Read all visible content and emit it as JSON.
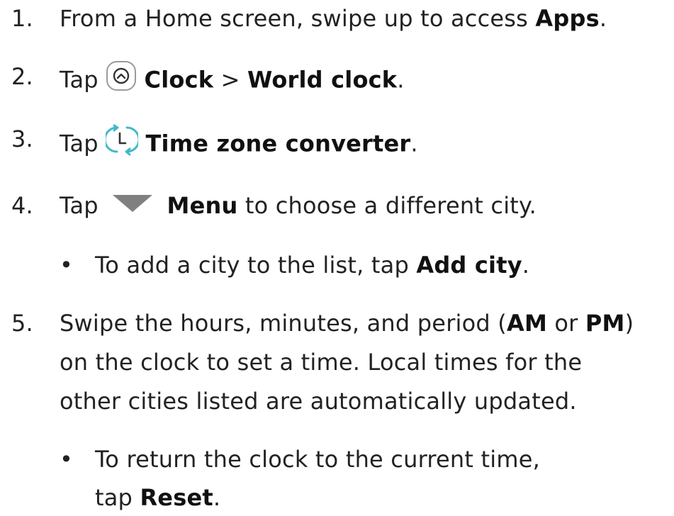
{
  "colors": {
    "text": "#222222",
    "icon_teal": "#3fb8c9",
    "icon_gray": "#808080"
  },
  "steps": [
    {
      "number": "1.",
      "prefix": "From a Home screen, swipe up to access ",
      "bold": "Apps",
      "suffix": "."
    },
    {
      "number": "2.",
      "prefix": "Tap",
      "icon": "clock-app-icon",
      "bold1": "Clock",
      "separator": " > ",
      "bold2": "World clock",
      "suffix": "."
    },
    {
      "number": "3.",
      "prefix": "Tap",
      "icon": "time-zone-converter-icon",
      "bold": "Time zone converter",
      "suffix": "."
    },
    {
      "number": "4.",
      "prefix": "Tap",
      "icon": "menu-triangle-icon",
      "bold": "Menu",
      "suffix": " to choose a different city.",
      "bullet": {
        "marker": "•",
        "prefix": "To add a city to the list, tap ",
        "bold": "Add city",
        "suffix": "."
      }
    },
    {
      "number": "5.",
      "line1_prefix": "Swipe the hours, minutes, and period (",
      "line1_bold1": "AM",
      "line1_mid": " or ",
      "line1_bold2": "PM",
      "line1_suffix": ")",
      "line2": "on the clock to set a time. Local times for the",
      "line3": "other cities listed are automatically updated.",
      "bullet": {
        "marker": "•",
        "line1": "To return the clock to the current time,",
        "line2_prefix": "tap ",
        "line2_bold": "Reset",
        "line2_suffix": "."
      }
    }
  ]
}
